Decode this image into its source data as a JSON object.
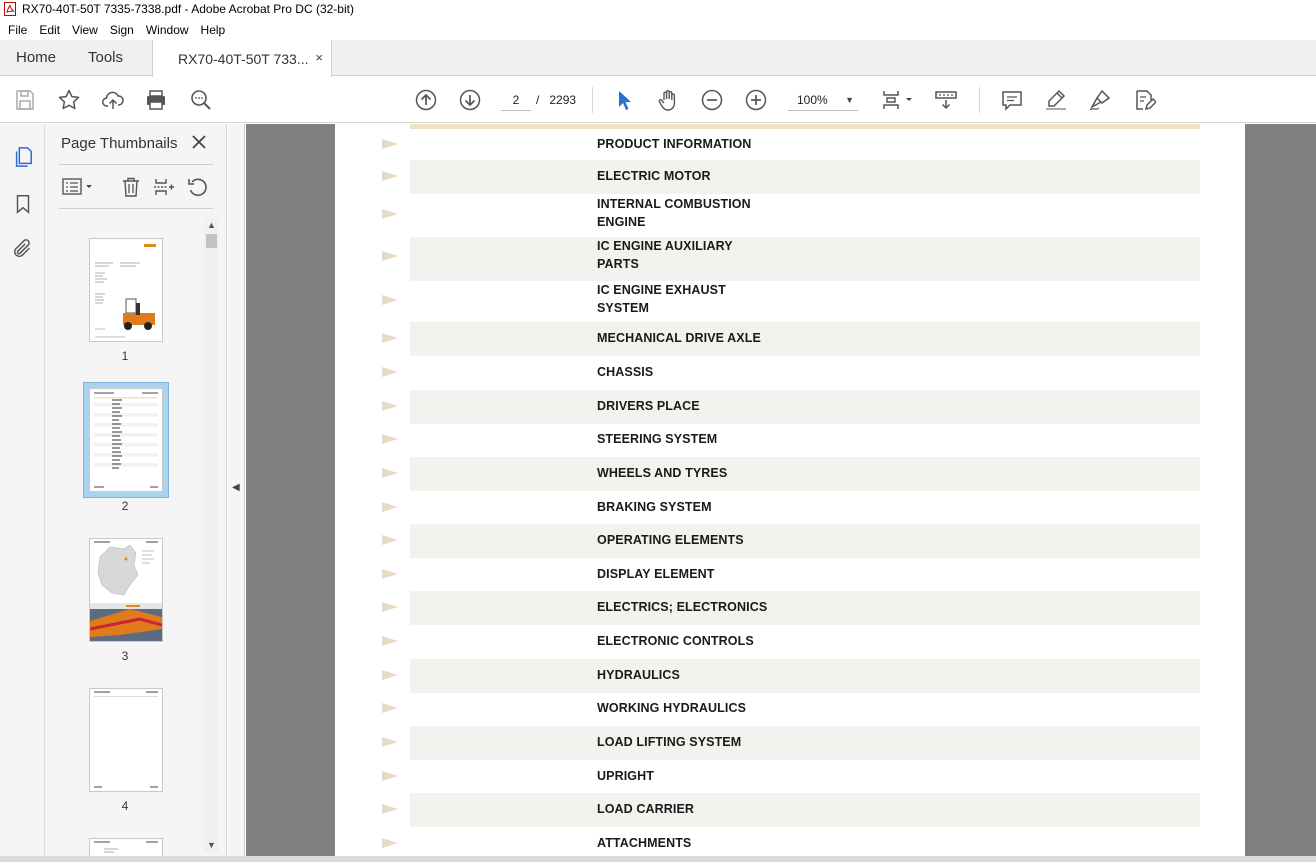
{
  "window": {
    "title": "RX70-40T-50T 7335-7338.pdf - Adobe Acrobat Pro DC (32-bit)"
  },
  "menu": [
    "File",
    "Edit",
    "View",
    "Sign",
    "Window",
    "Help"
  ],
  "tabs": {
    "home": "Home",
    "tools": "Tools",
    "document": "RX70-40T-50T 733...",
    "close": "×"
  },
  "toolbar": {
    "current_page": "2",
    "page_separator": "/",
    "total_pages": "2293",
    "zoom": "100%"
  },
  "thumbnails_panel": {
    "title": "Page Thumbnails",
    "close": "×",
    "pages": [
      {
        "number": "1",
        "selected": false
      },
      {
        "number": "2",
        "selected": true
      },
      {
        "number": "3",
        "selected": false
      },
      {
        "number": "4",
        "selected": false
      }
    ]
  },
  "document": {
    "entries": [
      "PRODUCT INFORMATION",
      "ELECTRIC MOTOR",
      "INTERNAL COMBUSTION\nENGINE",
      "IC ENGINE AUXILIARY\nPARTS",
      "IC ENGINE EXHAUST\nSYSTEM",
      "MECHANICAL DRIVE AXLE",
      "CHASSIS",
      "DRIVERS PLACE",
      "STEERING SYSTEM",
      "WHEELS AND TYRES",
      "BRAKING SYSTEM",
      "OPERATING ELEMENTS",
      "DISPLAY ELEMENT",
      "ELECTRICS; ELECTRONICS",
      "ELECTRONIC CONTROLS",
      "HYDRAULICS",
      "WORKING HYDRAULICS",
      "LOAD LIFTING SYSTEM",
      "UPRIGHT",
      "LOAD CARRIER",
      "ATTACHMENTS"
    ]
  },
  "colors": {
    "accent_blue": "#2a6ecf",
    "selection": "#a8d4ef",
    "doc_background": "#808080",
    "row_shade": "#f2f2ef",
    "arrow": "#e6dcc6"
  }
}
